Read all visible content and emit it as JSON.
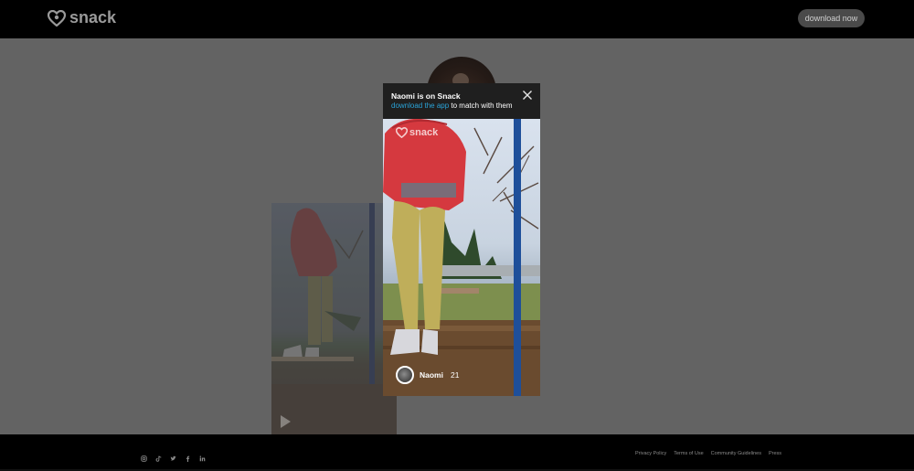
{
  "header": {
    "logo_text": "snack",
    "download_button": "download now"
  },
  "modal": {
    "title": "Naomi is on Snack",
    "link_text": "download the app",
    "sub_text": " to match with them",
    "watermark": "snack",
    "user_name": "Naomi",
    "user_age": "21"
  },
  "footer": {
    "social_icons": [
      "instagram-icon",
      "tiktok-icon",
      "twitter-icon",
      "facebook-icon",
      "linkedin-icon"
    ],
    "links": [
      "Privacy Policy",
      "Terms of Use",
      "Community Guidelines",
      "Press"
    ]
  },
  "colors": {
    "link": "#2aa3d8",
    "backdrop": "#636363",
    "bar": "#000000"
  }
}
